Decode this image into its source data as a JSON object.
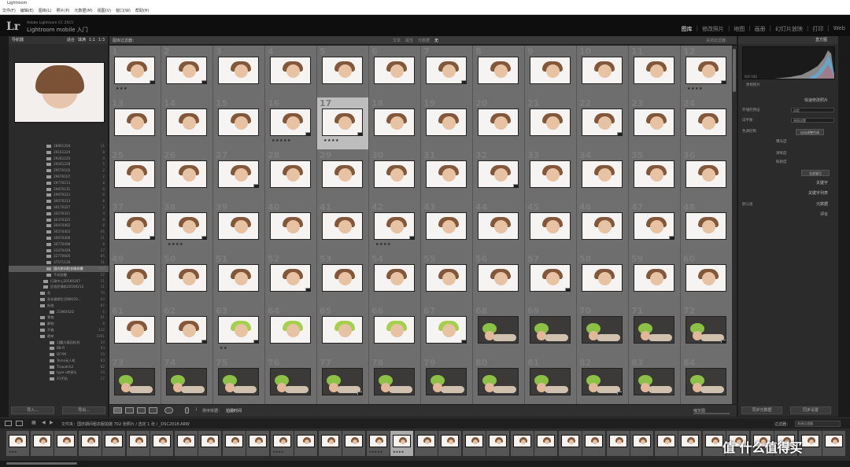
{
  "window": {
    "title": "Lightroom"
  },
  "menu": [
    "文件(F)",
    "编辑(E)",
    "图库(L)",
    "照片(P)",
    "元数据(M)",
    "视图(V)",
    "窗口(W)",
    "帮助(H)"
  ],
  "identity_plate": {
    "logo": "Lr",
    "product": "Adobe Lightroom CC 2015",
    "label": "Lightroom mobile 入门"
  },
  "modules": [
    {
      "label": "图库",
      "active": true
    },
    {
      "label": "修改照片"
    },
    {
      "label": "地图"
    },
    {
      "label": "画册"
    },
    {
      "label": "幻灯片放映"
    },
    {
      "label": "打印"
    },
    {
      "label": "Web"
    }
  ],
  "left_panel": {
    "navigator": {
      "title": "导航器",
      "options": [
        "适合",
        "填满",
        "1:1",
        "1:3"
      ]
    },
    "folders": [
      {
        "name": "28961204",
        "count": "11"
      },
      {
        "name": "29161224",
        "count": "8"
      },
      {
        "name": "29261225",
        "count": "9"
      },
      {
        "name": "29261228",
        "count": "5"
      },
      {
        "name": "29570102",
        "count": "2"
      },
      {
        "name": "29670107",
        "count": "2"
      },
      {
        "name": "29770113",
        "count": "8"
      },
      {
        "name": "29870131",
        "count": "6"
      },
      {
        "name": "29970211",
        "count": "6"
      },
      {
        "name": "30070213",
        "count": "8"
      },
      {
        "name": "30170227",
        "count": "2"
      },
      {
        "name": "30270311",
        "count": "4"
      },
      {
        "name": "30370325",
        "count": "8"
      },
      {
        "name": "30470402",
        "count": "8"
      },
      {
        "name": "30570403",
        "count": "46"
      },
      {
        "name": "30670406",
        "count": "21"
      },
      {
        "name": "30770408",
        "count": "8"
      },
      {
        "name": "31470429",
        "count": "27"
      },
      {
        "name": "32770605",
        "count": "85"
      },
      {
        "name": "37571126",
        "count": "21"
      },
      {
        "name": "国庆期间租衣服拍摄",
        "count": "702",
        "selected": true
      },
      {
        "name": "手机拍摄",
        "count": "37"
      },
      {
        "name": "行政中心20160207",
        "count": "11"
      },
      {
        "name": "民俗民情前20160212",
        "count": "11"
      },
      {
        "name": "花",
        "count": "70"
      },
      {
        "name": "浙东婚嫁生活明时20...",
        "count": "83"
      },
      {
        "name": "街拍",
        "count": "87"
      },
      {
        "name": "2186042D",
        "count": "6"
      },
      {
        "name": "景物",
        "count": "61"
      },
      {
        "name": "静物",
        "count": "8"
      },
      {
        "name": "开箱",
        "count": "132"
      },
      {
        "name": "晒单",
        "count": "1991"
      },
      {
        "name": "2J魔方基因检测",
        "count": "54"
      },
      {
        "name": "BB-R",
        "count": "83"
      },
      {
        "name": "DFYM",
        "count": "10"
      },
      {
        "name": "Temo无人机",
        "count": "83"
      },
      {
        "name": "Ticwatch2",
        "count": "82"
      },
      {
        "name": "type-c转接头",
        "count": "24"
      },
      {
        "name": "X1手机",
        "count": "17"
      }
    ],
    "import_label": "导入...",
    "export_label": "导出..."
  },
  "filter_bar": {
    "title": "图库过滤器：",
    "options": [
      {
        "label": "文本"
      },
      {
        "label": "属性"
      },
      {
        "label": "元数据"
      },
      {
        "label": "无",
        "active": true
      }
    ],
    "right": "关闭过滤器"
  },
  "grid": {
    "columns": 12,
    "cells": [
      {
        "num": "1",
        "stars": "★★★",
        "variant": "face"
      },
      {
        "num": "2"
      },
      {
        "num": "3"
      },
      {
        "num": "4"
      },
      {
        "num": "5"
      },
      {
        "num": "6"
      },
      {
        "num": "7"
      },
      {
        "num": "8"
      },
      {
        "num": "9"
      },
      {
        "num": "10"
      },
      {
        "num": "11"
      },
      {
        "num": "12",
        "stars": "★★★★"
      },
      {
        "num": "13"
      },
      {
        "num": "14"
      },
      {
        "num": "15"
      },
      {
        "num": "16",
        "stars": "★★★★★"
      },
      {
        "num": "17",
        "stars": "★★★★",
        "selected": true
      },
      {
        "num": "18"
      },
      {
        "num": "19"
      },
      {
        "num": "20"
      },
      {
        "num": "21"
      },
      {
        "num": "22"
      },
      {
        "num": "23"
      },
      {
        "num": "24"
      },
      {
        "num": "25"
      },
      {
        "num": "26"
      },
      {
        "num": "27"
      },
      {
        "num": "28"
      },
      {
        "num": "29"
      },
      {
        "num": "30"
      },
      {
        "num": "31"
      },
      {
        "num": "32"
      },
      {
        "num": "33"
      },
      {
        "num": "34"
      },
      {
        "num": "35"
      },
      {
        "num": "36"
      },
      {
        "num": "37"
      },
      {
        "num": "38",
        "stars": "★★★★"
      },
      {
        "num": "39"
      },
      {
        "num": "40"
      },
      {
        "num": "41"
      },
      {
        "num": "42",
        "stars": "★★★★"
      },
      {
        "num": "43"
      },
      {
        "num": "44"
      },
      {
        "num": "45"
      },
      {
        "num": "46"
      },
      {
        "num": "47"
      },
      {
        "num": "48"
      },
      {
        "num": "49"
      },
      {
        "num": "50"
      },
      {
        "num": "51"
      },
      {
        "num": "52"
      },
      {
        "num": "53"
      },
      {
        "num": "54"
      },
      {
        "num": "55"
      },
      {
        "num": "56"
      },
      {
        "num": "57"
      },
      {
        "num": "58"
      },
      {
        "num": "59"
      },
      {
        "num": "60"
      },
      {
        "num": "61"
      },
      {
        "num": "62"
      },
      {
        "num": "63",
        "stars": "★★",
        "variant": "green"
      },
      {
        "num": "64",
        "variant": "green"
      },
      {
        "num": "65",
        "variant": "green"
      },
      {
        "num": "66",
        "variant": "green"
      },
      {
        "num": "67",
        "variant": "green"
      },
      {
        "num": "68",
        "variant": "dark"
      },
      {
        "num": "69",
        "variant": "dark"
      },
      {
        "num": "70",
        "variant": "dark"
      },
      {
        "num": "71",
        "variant": "dark"
      },
      {
        "num": "72",
        "variant": "dark"
      },
      {
        "num": "73",
        "variant": "dark"
      },
      {
        "num": "74",
        "variant": "dark"
      },
      {
        "num": "75",
        "variant": "dark"
      },
      {
        "num": "76",
        "variant": "dark"
      },
      {
        "num": "77",
        "variant": "dark"
      },
      {
        "num": "78",
        "variant": "dark"
      },
      {
        "num": "79",
        "variant": "dark"
      },
      {
        "num": "80",
        "variant": "dark"
      },
      {
        "num": "81",
        "variant": "dark"
      },
      {
        "num": "82",
        "variant": "dark"
      },
      {
        "num": "83",
        "variant": "dark"
      },
      {
        "num": "84",
        "variant": "dark"
      }
    ]
  },
  "toolbar": {
    "sort_label": "排序依据：",
    "sort_value": "拍摄时间",
    "thumb_label": "缩览图"
  },
  "right_panel": {
    "histogram_title": "直方图",
    "histogram_info_left": "ISO 100",
    "histogram_info_right": "f/4.0",
    "original_photo": "原始照片",
    "quick_develop": "快速修改照片",
    "saved_preset_label": "存储的预设",
    "saved_preset_value": "自定",
    "white_balance_label": "白平衡",
    "white_balance_value": "原照设置",
    "tone_label": "色调控制",
    "auto_tone": "自动调整色调",
    "exposure": "曝光度",
    "clarity": "清晰度",
    "vibrance": "鲜艳度",
    "reset_all": "全部复位",
    "keywording": "关键字",
    "keyword_list": "关键字列表",
    "default_label": "默认值",
    "metadata": "元数据",
    "comments": "评论",
    "sync_metadata": "同步元数据",
    "sync_settings": "同步设置"
  },
  "filmstrip_bar": {
    "breadcrumb": "文件夹：国庆期间租衣服拍摄  702 张照片 / 选定 1 张 / _DSC2018.ARW",
    "filter_label": "过滤器：",
    "filter_value": "关闭过滤器"
  },
  "filmstrip": {
    "thumbs": [
      {
        "stars": "★★★"
      },
      {
        "stars": ""
      },
      {
        "stars": ""
      },
      {
        "stars": ""
      },
      {
        "stars": ""
      },
      {
        "stars": ""
      },
      {
        "stars": ""
      },
      {
        "stars": ""
      },
      {
        "stars": ""
      },
      {
        "stars": ""
      },
      {
        "stars": ""
      },
      {
        "stars": "★★★★"
      },
      {
        "stars": ""
      },
      {
        "stars": ""
      },
      {
        "stars": ""
      },
      {
        "stars": "★★★★★"
      },
      {
        "stars": "★★★★",
        "selected": true
      },
      {
        "stars": ""
      },
      {
        "stars": ""
      },
      {
        "stars": ""
      },
      {
        "stars": ""
      },
      {
        "stars": ""
      },
      {
        "stars": ""
      },
      {
        "stars": ""
      },
      {
        "stars": ""
      },
      {
        "stars": ""
      },
      {
        "stars": ""
      },
      {
        "stars": ""
      },
      {
        "stars": ""
      },
      {
        "stars": ""
      },
      {
        "stars": ""
      },
      {
        "stars": ""
      },
      {
        "stars": ""
      },
      {
        "stars": ""
      },
      {
        "stars": ""
      }
    ]
  },
  "watermark": "值 什么值得买"
}
